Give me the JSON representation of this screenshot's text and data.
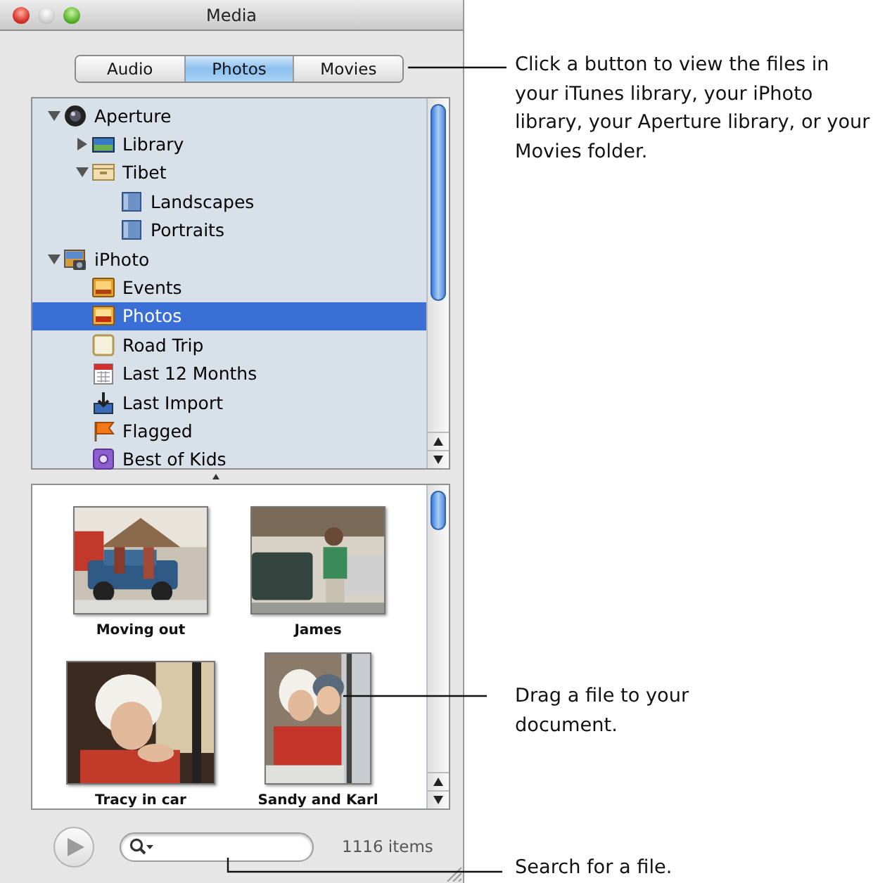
{
  "window": {
    "title": "Media"
  },
  "tabs": [
    {
      "label": "Audio",
      "selected": false
    },
    {
      "label": "Photos",
      "selected": true
    },
    {
      "label": "Movies",
      "selected": false
    }
  ],
  "tree": [
    {
      "label": "Aperture",
      "kind": "lens",
      "expanded": true,
      "selected": false,
      "children": [
        {
          "label": "Library",
          "kind": "library",
          "expanded": false,
          "selected": false
        },
        {
          "label": "Tibet",
          "kind": "project",
          "expanded": true,
          "selected": false,
          "children": [
            {
              "label": "Landscapes",
              "kind": "album",
              "selected": false
            },
            {
              "label": "Portraits",
              "kind": "album",
              "selected": false
            }
          ]
        }
      ]
    },
    {
      "label": "iPhoto",
      "kind": "iphoto",
      "expanded": true,
      "selected": false,
      "children": [
        {
          "label": "Events",
          "kind": "events",
          "selected": false
        },
        {
          "label": "Photos",
          "kind": "photos",
          "selected": true
        },
        {
          "label": "Road Trip",
          "kind": "blank-album",
          "selected": false
        },
        {
          "label": "Last 12 Months",
          "kind": "calendar",
          "selected": false
        },
        {
          "label": "Last Import",
          "kind": "import",
          "selected": false
        },
        {
          "label": "Flagged",
          "kind": "flag",
          "selected": false
        },
        {
          "label": "Best of Kids",
          "kind": "smart",
          "selected": false
        }
      ]
    }
  ],
  "thumbnails": [
    {
      "caption": "Moving out",
      "kind": "picture"
    },
    {
      "caption": "James",
      "kind": "picture"
    },
    {
      "caption": "Tracy in car",
      "kind": "picture"
    },
    {
      "caption": "Sandy and Karl",
      "kind": "picture"
    }
  ],
  "item_count": "1116 items",
  "callouts": [
    {
      "text": "Click a button to view the files in your iTunes library, your iPhoto library, your Aperture library, or your Movies folder."
    },
    {
      "text": "Drag a file to your document."
    },
    {
      "text": "Search for a file."
    }
  ]
}
